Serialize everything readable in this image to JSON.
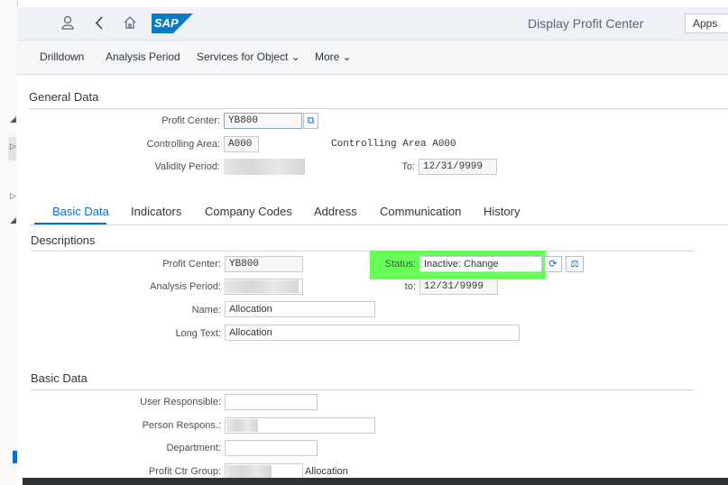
{
  "shell": {
    "title": "Display Profit Center",
    "apps_label": "Apps",
    "logo_text": "SAP"
  },
  "toolbar": {
    "items": [
      "Drilldown",
      "Analysis Period",
      "Services for Object ⌄",
      "More ⌄"
    ]
  },
  "general": {
    "title": "General Data",
    "profit_center_label": "Profit Center:",
    "profit_center_value": "YB800",
    "controlling_area_label": "Controlling Area:",
    "controlling_area_value": "A000",
    "controlling_area_text": "Controlling Area A000",
    "validity_label": "Validity Period:",
    "to_label": "To:",
    "to_value": "12/31/9999"
  },
  "tabs": [
    "Basic Data",
    "Indicators",
    "Company Codes",
    "Address",
    "Communication",
    "History"
  ],
  "descriptions": {
    "title": "Descriptions",
    "profit_center_label": "Profit Center:",
    "profit_center_value": "YB800",
    "status_label": "Status:",
    "status_value": "Inactive: Change",
    "analysis_label": "Analysis Period:",
    "to_label": "to:",
    "to_value": "12/31/9999",
    "name_label": "Name:",
    "name_value": "Allocation",
    "long_text_label": "Long Text:",
    "long_text_value": "Allocation"
  },
  "basic": {
    "title": "Basic Data",
    "user_label": "User Responsible:",
    "person_label": "Person Respons.:",
    "department_label": "Department:",
    "group_label": "Profit Ctr Group:",
    "group_text": "Allocation"
  },
  "colors": {
    "highlight": "#4cff3a",
    "accent": "#0a6ed1"
  }
}
